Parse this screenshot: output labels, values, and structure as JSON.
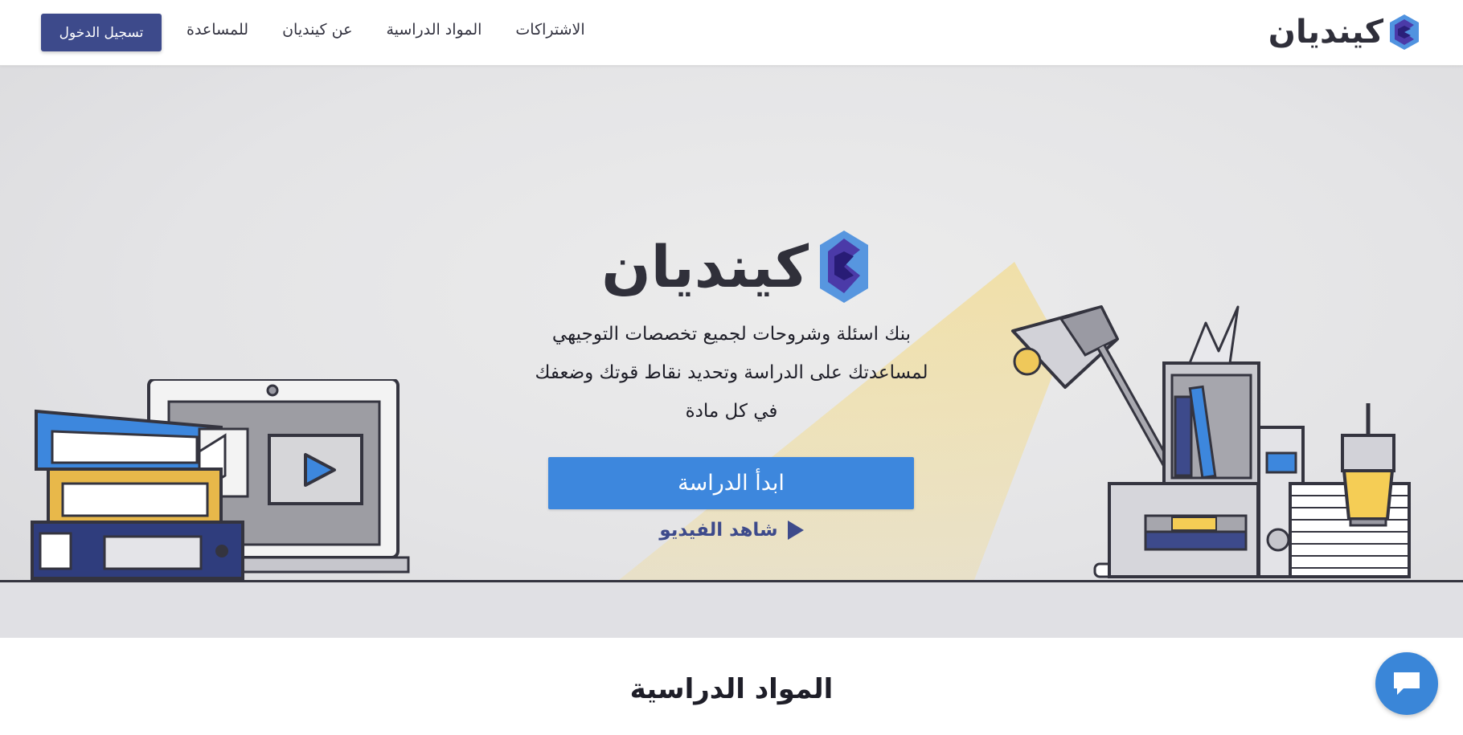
{
  "brand": {
    "name": "كينديان",
    "logo_icon": "kindian-logo-icon",
    "accent": "#3d4a8b"
  },
  "nav": {
    "items": [
      {
        "label": "للمساعدة"
      },
      {
        "label": "عن كينديان"
      },
      {
        "label": "المواد الدراسية"
      },
      {
        "label": "الاشتراكات"
      }
    ],
    "login_label": "تسجيل الدخول"
  },
  "hero": {
    "logo_text": "كينديان",
    "tagline": [
      "بنك اسئلة وشروحات لجميع تخصصات التوجيهي",
      "لمساعدتك على الدراسة وتحديد نقاط قوتك وضعفك",
      "في كل مادة"
    ],
    "start_label": "ابدأ الدراسة",
    "video_label": "شاهد الفيديو",
    "video_icon": "play-icon",
    "button_color": "#3d87dd"
  },
  "section": {
    "title": "المواد الدراسية"
  },
  "chat": {
    "icon": "chat-bubble-icon",
    "color": "#3a86d8"
  }
}
